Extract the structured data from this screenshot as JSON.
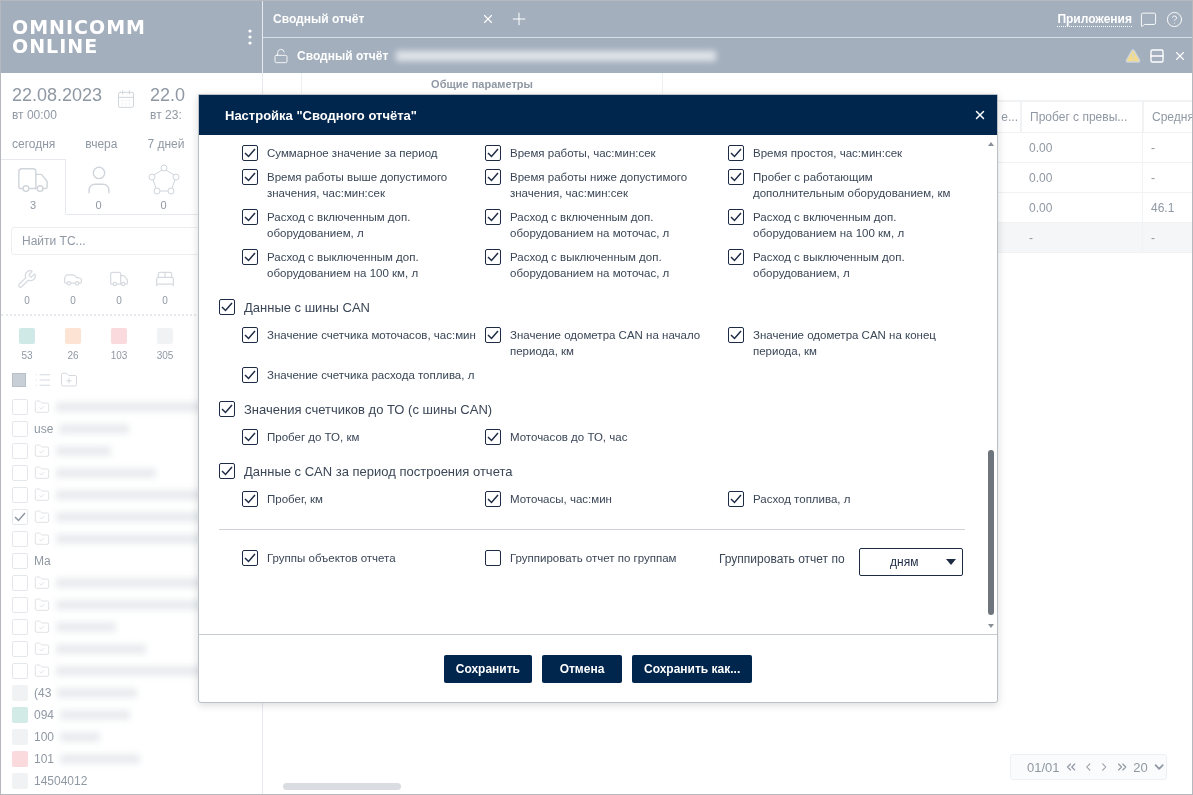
{
  "sidebar": {
    "logo": [
      "OMNICOMM",
      "ONLINE"
    ],
    "date_from": {
      "date": "22.08.2023",
      "time": "вт 00:00"
    },
    "date_to": {
      "date": "22.0",
      "time": "вт 23:"
    },
    "quick_ranges": [
      "сегодня",
      "вчера",
      "7 дней"
    ],
    "object_tabs": [
      {
        "kind": "vehicles",
        "count": "3",
        "selected": true
      },
      {
        "kind": "drivers",
        "count": "0",
        "selected": false
      },
      {
        "kind": "geozones",
        "count": "0",
        "selected": false
      }
    ],
    "search": {
      "placeholder": "Найти ТС..."
    },
    "status_counts": [
      {
        "kind": "repair",
        "count": "0"
      },
      {
        "kind": "accident",
        "count": "0"
      },
      {
        "kind": "transport",
        "count": "0"
      },
      {
        "kind": "parking",
        "count": "0"
      }
    ],
    "color_counts": [
      {
        "color": "#cfe9e6",
        "count": "53"
      },
      {
        "color": "#fde3d3",
        "count": "26"
      },
      {
        "color": "#fadadd",
        "count": "103"
      },
      {
        "color": "#f1f2f4",
        "count": "305"
      }
    ],
    "select_all": {
      "checked": true
    },
    "tree": [
      {
        "kind": "folder",
        "checked": false
      },
      {
        "kind": "item",
        "checked": false,
        "label": "use"
      },
      {
        "kind": "folder",
        "checked": false
      },
      {
        "kind": "folder",
        "checked": false
      },
      {
        "kind": "folder",
        "checked": false
      },
      {
        "kind": "folder",
        "checked": true
      },
      {
        "kind": "folder",
        "checked": false
      },
      {
        "kind": "item",
        "checked": false,
        "label": "Ma"
      },
      {
        "kind": "folder",
        "checked": false
      },
      {
        "kind": "folder",
        "checked": false
      },
      {
        "kind": "folder",
        "checked": false
      },
      {
        "kind": "folder",
        "checked": false
      },
      {
        "kind": "folder",
        "checked": false
      },
      {
        "kind": "vehicle",
        "color": "#f1f2f4",
        "label": "(43"
      },
      {
        "kind": "vehicle",
        "color": "#d3ebe6",
        "label": "094"
      },
      {
        "kind": "vehicle",
        "color": "#f1f2f4",
        "label": "100"
      },
      {
        "kind": "vehicle",
        "color": "#fadadd",
        "label": "101"
      },
      {
        "kind": "vehicle",
        "color": "#f1f2f4",
        "label": "14504012"
      }
    ]
  },
  "tabs": [
    {
      "label": "Сводный отчёт",
      "selected": true
    }
  ],
  "apps_link": "Приложения",
  "report_bar": {
    "title": "Сводный отчёт"
  },
  "table": {
    "group_header": "Общие параметры",
    "cut_header": "е...",
    "columns": [
      "Пробег с превы...",
      "Средня"
    ],
    "rows": [
      {
        "kind": "data",
        "cells": [
          "0.00",
          "-"
        ]
      },
      {
        "kind": "data",
        "cells": [
          "0.00",
          "-"
        ]
      },
      {
        "kind": "data",
        "cells": [
          "0.00",
          "46.1"
        ]
      },
      {
        "kind": "total",
        "cells": [
          "-",
          "-"
        ]
      }
    ]
  },
  "pagination": {
    "page": "01/01",
    "per_page": "20"
  },
  "dialog": {
    "title": "Настройка \"Сводного отчёта\"",
    "groups": [
      {
        "items": [
          {
            "label": "Суммарное значение за период",
            "checked": true
          },
          {
            "label": "Время работы, час:мин:сек",
            "checked": true
          },
          {
            "label": "Время простоя, час:мин:сек",
            "checked": true
          },
          {
            "label": "Время работы выше допустимого значения, час:мин:сек",
            "checked": true
          },
          {
            "label": "Время работы ниже допустимого значения, час:мин:сек",
            "checked": true
          },
          {
            "label": "Пробег с работающим дополнительным оборудованием, км",
            "checked": true
          },
          {
            "label": "Расход с включенным доп. оборудованием, л",
            "checked": true
          },
          {
            "label": "Расход с включенным доп. оборудованием на моточас, л",
            "checked": true
          },
          {
            "label": "Расход с включенным доп. оборудованием на 100 км, л",
            "checked": true
          },
          {
            "label": "Расход с выключенным доп. оборудованием на 100 км, л",
            "checked": true
          },
          {
            "label": "Расход с выключенным доп. оборудованием на моточас, л",
            "checked": true
          },
          {
            "label": "Расход с выключенным доп. оборудованием, л",
            "checked": true
          }
        ]
      },
      {
        "title": "Данные с шины CAN",
        "checked": true,
        "items": [
          {
            "label": "Значение счетчика моточасов, час:мин",
            "checked": true
          },
          {
            "label": "Значение одометра CAN на начало периода, км",
            "checked": true
          },
          {
            "label": "Значение одометра CAN на конец периода, км",
            "checked": true
          },
          {
            "label": "Значение счетчика расхода топлива, л",
            "checked": true
          }
        ]
      },
      {
        "title": "Значения счетчиков до ТО (с шины CAN)",
        "checked": true,
        "items": [
          {
            "label": "Пробег до ТО, км",
            "checked": true
          },
          {
            "label": "Моточасов до ТО, час",
            "checked": true
          }
        ]
      },
      {
        "title": "Данные с CAN за период построения отчета",
        "checked": true,
        "items": [
          {
            "label": "Пробег, км",
            "checked": true
          },
          {
            "label": "Моточасы, час:мин",
            "checked": true
          },
          {
            "label": "Расход топлива, л",
            "checked": true
          }
        ]
      }
    ],
    "options": [
      {
        "label": "Группы объектов отчета",
        "checked": true
      },
      {
        "label": "Группировать отчет по группам",
        "checked": false
      }
    ],
    "group_by": {
      "label": "Группировать отчет по",
      "value": "дням"
    },
    "buttons": [
      "Сохранить",
      "Отмена",
      "Сохранить как..."
    ]
  }
}
